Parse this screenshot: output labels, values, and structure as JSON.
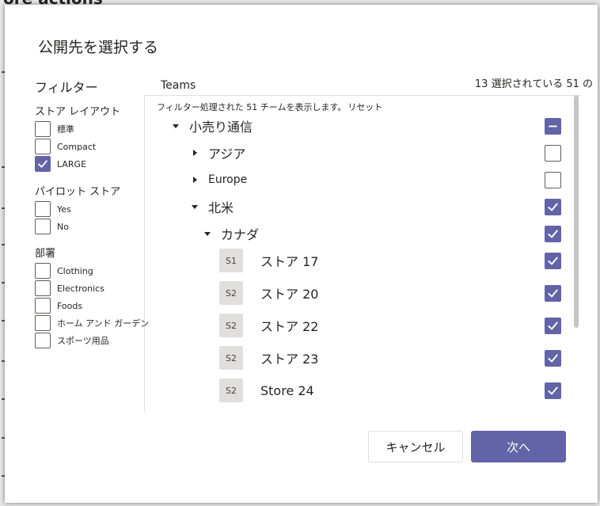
{
  "background": {
    "page_title_fragment": "ore actions"
  },
  "dialog": {
    "title": "公開先を選択する"
  },
  "filters": {
    "heading": "フィルター",
    "groups": [
      {
        "label": "ストア レイアウト",
        "options": [
          {
            "label": "標準",
            "checked": false
          },
          {
            "label": "Compact",
            "checked": false
          },
          {
            "label": "LARGE",
            "checked": true
          }
        ]
      },
      {
        "label": "パイロット ストア",
        "options": [
          {
            "label": "Yes",
            "checked": false
          },
          {
            "label": "No",
            "checked": false
          }
        ]
      },
      {
        "label": "部署",
        "options": [
          {
            "label": "Clothing",
            "checked": false
          },
          {
            "label": "Electronics",
            "checked": false
          },
          {
            "label": "Foods",
            "checked": false
          },
          {
            "label": "ホーム アンド ガーデン",
            "checked": false
          },
          {
            "label": "スポーツ用品",
            "checked": false
          }
        ]
      }
    ]
  },
  "teams": {
    "heading": "Teams",
    "selection_count": "13 選択されている 51 の",
    "status_text": "フィルター処理された 51 チームを表示します。",
    "reset_label": "リセット"
  },
  "tree": [
    {
      "label": "小売り通信",
      "level": 0,
      "toggle": "expanded",
      "avatar": "",
      "state": "indeterminate"
    },
    {
      "label": "アジア",
      "level": 1,
      "toggle": "collapsed",
      "avatar": "",
      "state": "unchecked"
    },
    {
      "label": "Europe",
      "level": 1,
      "toggle": "collapsed",
      "avatar": "",
      "state": "unchecked"
    },
    {
      "label": "北米",
      "level": 1,
      "toggle": "expanded",
      "avatar": "",
      "state": "checked"
    },
    {
      "label": "カナダ",
      "level": 2,
      "toggle": "expanded",
      "avatar": "",
      "state": "checked"
    },
    {
      "label": "ストア 17",
      "level": 3,
      "toggle": "",
      "avatar": "S1",
      "state": "checked"
    },
    {
      "label": "ストア 20",
      "level": 3,
      "toggle": "",
      "avatar": "S2",
      "state": "checked"
    },
    {
      "label": "ストア 22",
      "level": 3,
      "toggle": "",
      "avatar": "S2",
      "state": "checked"
    },
    {
      "label": "ストア 23",
      "level": 3,
      "toggle": "",
      "avatar": "S2",
      "state": "checked"
    },
    {
      "label": "Store 24",
      "level": 3,
      "toggle": "",
      "avatar": "S2",
      "state": "checked"
    }
  ],
  "buttons": {
    "cancel_label": "キャンセル",
    "next_label": "次へ"
  },
  "colors": {
    "accent": "#6264a7",
    "overlay": "#3b3b3b"
  },
  "icons": {
    "expanded": "caret-down-icon",
    "collapsed": "caret-right-icon",
    "checked": "checkmark-icon",
    "indeterminate": "dash-icon"
  }
}
